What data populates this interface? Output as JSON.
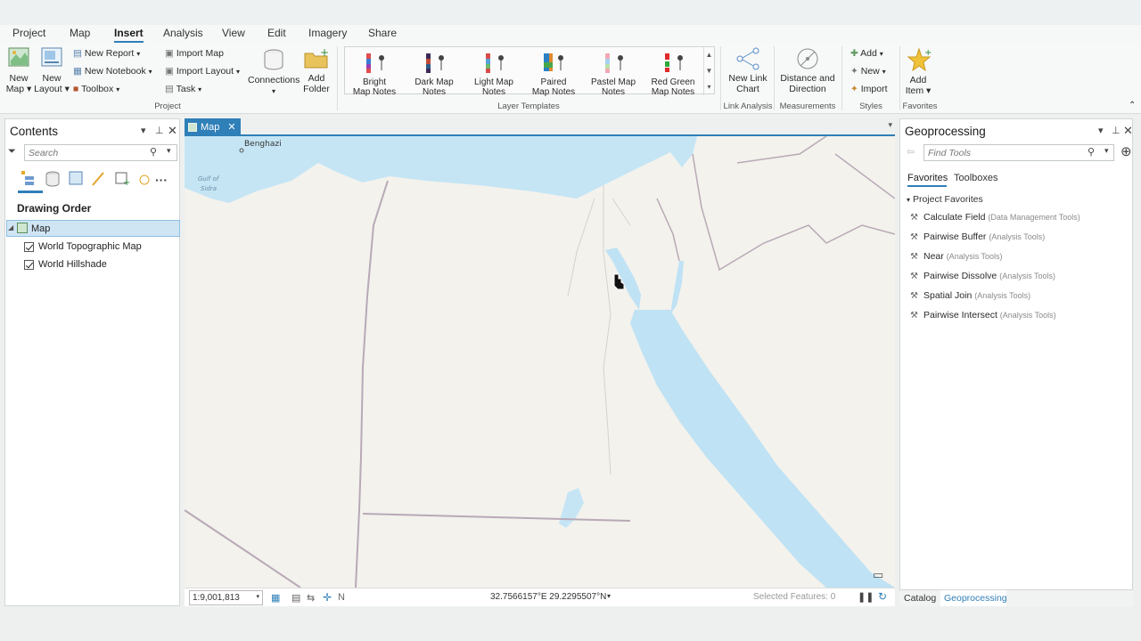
{
  "tabs": [
    "Project",
    "Map",
    "Insert",
    "Analysis",
    "View",
    "Edit",
    "Imagery",
    "Share"
  ],
  "ribbon": {
    "new_map": "New\nMap ▾",
    "new_layout": "New\nLayout ▾",
    "new_report": "New Report",
    "new_notebook": "New Notebook",
    "toolbox": "Toolbox",
    "import_map": "Import Map",
    "import_layout": "Import Layout",
    "task": "Task",
    "connections": "Connections",
    "add_folder": "Add\nFolder",
    "project_group": "Project",
    "gallery": [
      "Bright\nMap Notes",
      "Dark Map\nNotes",
      "Light Map\nNotes",
      "Paired\nMap Notes",
      "Pastel Map\nNotes",
      "Red Green\nMap Notes"
    ],
    "layer_templates_group": "Layer Templates",
    "new_link_chart": "New Link\nChart",
    "link_analysis_group": "Link Analysis",
    "distance_direction": "Distance and\nDirection",
    "measurements_group": "Measurements",
    "styles_add": "Add",
    "styles_new": "New",
    "styles_import": "Import",
    "styles_group": "Styles",
    "add_item": "Add\nItem ▾",
    "favorites_group": "Favorites"
  },
  "contents": {
    "title": "Contents",
    "search_placeholder": "Search",
    "drawing_order": "Drawing Order",
    "map_item": "Map",
    "layers": [
      "World Topographic Map",
      "World Hillshade"
    ]
  },
  "map": {
    "tab": "Map",
    "labels": {
      "benghazi": "Benghazi",
      "gulf1": "Gulf of",
      "gulf2": "Sidra"
    },
    "scale": "1:9,001,813",
    "coords": "32.7566157°E 29.2295507°N",
    "selected": "Selected Features: 0"
  },
  "geoprocessing": {
    "title": "Geoprocessing",
    "search_placeholder": "Find Tools",
    "tab_favorites": "Favorites",
    "tab_toolboxes": "Toolboxes",
    "section": "Project Favorites",
    "tools": [
      {
        "name": "Calculate Field",
        "box": "(Data Management Tools)"
      },
      {
        "name": "Pairwise Buffer",
        "box": "(Analysis Tools)"
      },
      {
        "name": "Near",
        "box": "(Analysis Tools)"
      },
      {
        "name": "Pairwise Dissolve",
        "box": "(Analysis Tools)"
      },
      {
        "name": "Spatial Join",
        "box": "(Analysis Tools)"
      },
      {
        "name": "Pairwise Intersect",
        "box": "(Analysis Tools)"
      }
    ]
  },
  "bottom_tabs": {
    "catalog": "Catalog",
    "geoprocessing": "Geoprocessing"
  }
}
